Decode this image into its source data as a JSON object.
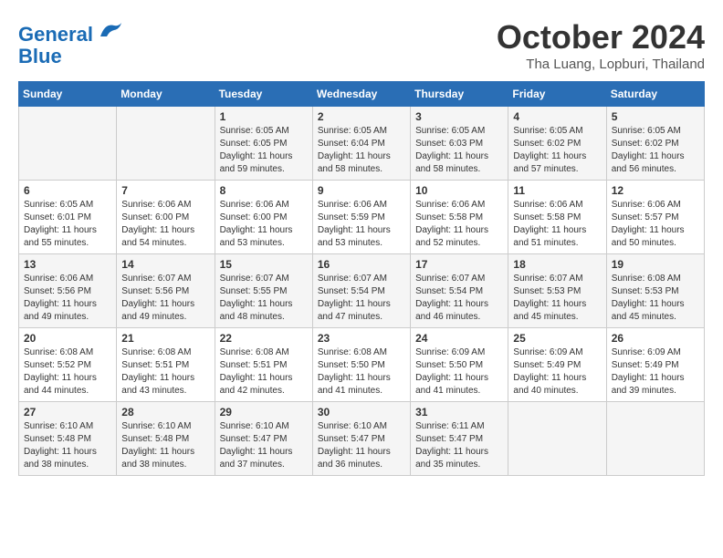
{
  "header": {
    "logo_line1": "General",
    "logo_line2": "Blue",
    "month_title": "October 2024",
    "subtitle": "Tha Luang, Lopburi, Thailand"
  },
  "days_of_week": [
    "Sunday",
    "Monday",
    "Tuesday",
    "Wednesday",
    "Thursday",
    "Friday",
    "Saturday"
  ],
  "weeks": [
    [
      {
        "day": "",
        "info": ""
      },
      {
        "day": "",
        "info": ""
      },
      {
        "day": "1",
        "info": "Sunrise: 6:05 AM\nSunset: 6:05 PM\nDaylight: 11 hours and 59 minutes."
      },
      {
        "day": "2",
        "info": "Sunrise: 6:05 AM\nSunset: 6:04 PM\nDaylight: 11 hours and 58 minutes."
      },
      {
        "day": "3",
        "info": "Sunrise: 6:05 AM\nSunset: 6:03 PM\nDaylight: 11 hours and 58 minutes."
      },
      {
        "day": "4",
        "info": "Sunrise: 6:05 AM\nSunset: 6:02 PM\nDaylight: 11 hours and 57 minutes."
      },
      {
        "day": "5",
        "info": "Sunrise: 6:05 AM\nSunset: 6:02 PM\nDaylight: 11 hours and 56 minutes."
      }
    ],
    [
      {
        "day": "6",
        "info": "Sunrise: 6:05 AM\nSunset: 6:01 PM\nDaylight: 11 hours and 55 minutes."
      },
      {
        "day": "7",
        "info": "Sunrise: 6:06 AM\nSunset: 6:00 PM\nDaylight: 11 hours and 54 minutes."
      },
      {
        "day": "8",
        "info": "Sunrise: 6:06 AM\nSunset: 6:00 PM\nDaylight: 11 hours and 53 minutes."
      },
      {
        "day": "9",
        "info": "Sunrise: 6:06 AM\nSunset: 5:59 PM\nDaylight: 11 hours and 53 minutes."
      },
      {
        "day": "10",
        "info": "Sunrise: 6:06 AM\nSunset: 5:58 PM\nDaylight: 11 hours and 52 minutes."
      },
      {
        "day": "11",
        "info": "Sunrise: 6:06 AM\nSunset: 5:58 PM\nDaylight: 11 hours and 51 minutes."
      },
      {
        "day": "12",
        "info": "Sunrise: 6:06 AM\nSunset: 5:57 PM\nDaylight: 11 hours and 50 minutes."
      }
    ],
    [
      {
        "day": "13",
        "info": "Sunrise: 6:06 AM\nSunset: 5:56 PM\nDaylight: 11 hours and 49 minutes."
      },
      {
        "day": "14",
        "info": "Sunrise: 6:07 AM\nSunset: 5:56 PM\nDaylight: 11 hours and 49 minutes."
      },
      {
        "day": "15",
        "info": "Sunrise: 6:07 AM\nSunset: 5:55 PM\nDaylight: 11 hours and 48 minutes."
      },
      {
        "day": "16",
        "info": "Sunrise: 6:07 AM\nSunset: 5:54 PM\nDaylight: 11 hours and 47 minutes."
      },
      {
        "day": "17",
        "info": "Sunrise: 6:07 AM\nSunset: 5:54 PM\nDaylight: 11 hours and 46 minutes."
      },
      {
        "day": "18",
        "info": "Sunrise: 6:07 AM\nSunset: 5:53 PM\nDaylight: 11 hours and 45 minutes."
      },
      {
        "day": "19",
        "info": "Sunrise: 6:08 AM\nSunset: 5:53 PM\nDaylight: 11 hours and 45 minutes."
      }
    ],
    [
      {
        "day": "20",
        "info": "Sunrise: 6:08 AM\nSunset: 5:52 PM\nDaylight: 11 hours and 44 minutes."
      },
      {
        "day": "21",
        "info": "Sunrise: 6:08 AM\nSunset: 5:51 PM\nDaylight: 11 hours and 43 minutes."
      },
      {
        "day": "22",
        "info": "Sunrise: 6:08 AM\nSunset: 5:51 PM\nDaylight: 11 hours and 42 minutes."
      },
      {
        "day": "23",
        "info": "Sunrise: 6:08 AM\nSunset: 5:50 PM\nDaylight: 11 hours and 41 minutes."
      },
      {
        "day": "24",
        "info": "Sunrise: 6:09 AM\nSunset: 5:50 PM\nDaylight: 11 hours and 41 minutes."
      },
      {
        "day": "25",
        "info": "Sunrise: 6:09 AM\nSunset: 5:49 PM\nDaylight: 11 hours and 40 minutes."
      },
      {
        "day": "26",
        "info": "Sunrise: 6:09 AM\nSunset: 5:49 PM\nDaylight: 11 hours and 39 minutes."
      }
    ],
    [
      {
        "day": "27",
        "info": "Sunrise: 6:10 AM\nSunset: 5:48 PM\nDaylight: 11 hours and 38 minutes."
      },
      {
        "day": "28",
        "info": "Sunrise: 6:10 AM\nSunset: 5:48 PM\nDaylight: 11 hours and 38 minutes."
      },
      {
        "day": "29",
        "info": "Sunrise: 6:10 AM\nSunset: 5:47 PM\nDaylight: 11 hours and 37 minutes."
      },
      {
        "day": "30",
        "info": "Sunrise: 6:10 AM\nSunset: 5:47 PM\nDaylight: 11 hours and 36 minutes."
      },
      {
        "day": "31",
        "info": "Sunrise: 6:11 AM\nSunset: 5:47 PM\nDaylight: 11 hours and 35 minutes."
      },
      {
        "day": "",
        "info": ""
      },
      {
        "day": "",
        "info": ""
      }
    ]
  ]
}
